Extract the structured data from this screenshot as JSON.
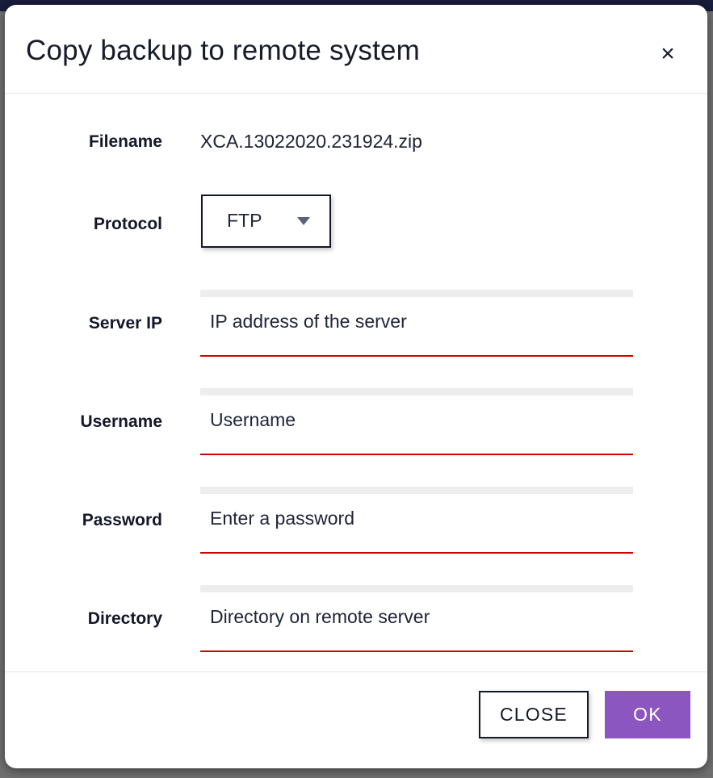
{
  "window": {
    "backdrop_color": "#6f6f6f",
    "top_strip_color": "#191d3c"
  },
  "dialog": {
    "title": "Copy backup to remote system",
    "close_icon": "×",
    "accent_color": "#8b56bf",
    "field_underline_color": "#d10000",
    "field_top_color": "#ededed"
  },
  "form": {
    "filename": {
      "label": "Filename",
      "value": "XCA.13022020.231924.zip"
    },
    "protocol": {
      "label": "Protocol",
      "selected": "FTP",
      "caret_icon": "chevron-down-icon"
    },
    "server_ip": {
      "label": "Server IP",
      "placeholder": "IP address of the server",
      "value": ""
    },
    "username": {
      "label": "Username",
      "placeholder": "Username",
      "value": ""
    },
    "password": {
      "label": "Password",
      "placeholder": "Enter a password",
      "value": ""
    },
    "directory": {
      "label": "Directory",
      "placeholder": "Directory on remote server",
      "value": ""
    }
  },
  "footer": {
    "close_label": "CLOSE",
    "ok_label": "OK"
  }
}
